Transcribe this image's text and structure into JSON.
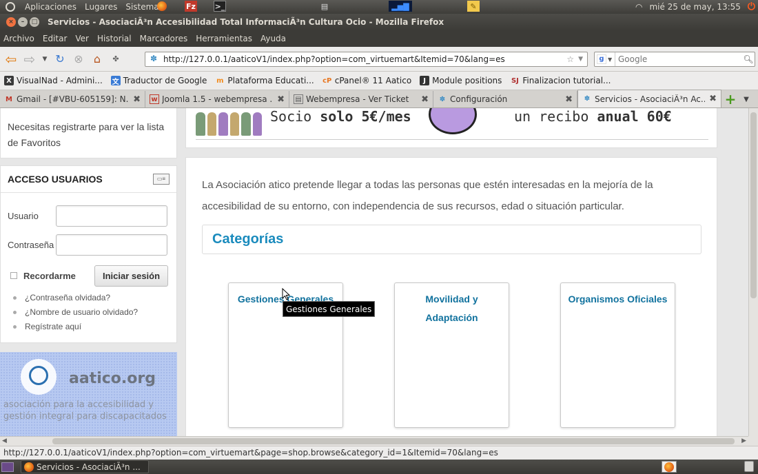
{
  "top_panel": {
    "menus": [
      "Aplicaciones",
      "Lugares",
      "Sistema"
    ],
    "clock": "mié 25 de may, 13:55",
    "app_icons": [
      "firefox-icon",
      "filezilla-icon",
      "terminal-icon",
      "network-icon",
      "system-monitor-icon",
      "notes-icon"
    ]
  },
  "window": {
    "title": "Servicios - AsociaciÃ³n Accesibilidad Total InformaciÃ³n Cultura Ocio - Mozilla Firefox"
  },
  "menubar": {
    "items": [
      "Archivo",
      "Editar",
      "Ver",
      "Historial",
      "Marcadores",
      "Herramientas",
      "Ayuda"
    ]
  },
  "navbar": {
    "url": "http://127.0.0.1/aaticoV1/index.php?option=com_virtuemart&Itemid=70&lang=es",
    "search_placeholder": "Google"
  },
  "bookmarks": [
    {
      "label": "VisualNad - Admini...",
      "icon": "visualnad-icon",
      "color": "#3a3a3a"
    },
    {
      "label": "Traductor de Google",
      "icon": "translate-icon",
      "color": "#3a7bd5"
    },
    {
      "label": "Plataforma Educati...",
      "icon": "moodle-icon",
      "color": "#f28c1e"
    },
    {
      "label": "cPanel® 11 Aatico",
      "icon": "cpanel-icon",
      "color": "#e87722"
    },
    {
      "label": "Module positions",
      "icon": "joomla-icon",
      "color": "#333333"
    },
    {
      "label": "Finalizacion tutorial...",
      "icon": "sj-icon",
      "color": "#b03030"
    }
  ],
  "tabs": [
    {
      "label": "Gmail - [#VBU-605159]: N...",
      "icon": "gmail-icon"
    },
    {
      "label": "Joomla 1.5 - webempresa ...",
      "icon": "webempresa-icon"
    },
    {
      "label": "Webempresa - Ver Ticket",
      "icon": "page-icon"
    },
    {
      "label": "Configuración",
      "icon": "site-icon"
    },
    {
      "label": "Servicios - AsociaciÃ³n Ac...",
      "icon": "site-icon"
    }
  ],
  "sidebar": {
    "favorites_notice": "Necesitas registrarte para ver la lista de Favoritos",
    "login": {
      "title": "ACCESO USUARIOS",
      "username_label": "Usuario",
      "password_label": "Contraseña",
      "remember_label": "Recordarme",
      "submit_label": "Iniciar sesión",
      "links": [
        "¿Contraseña olvidada?",
        "¿Nombre de usuario olvidado?",
        "Regístrate aquí"
      ]
    },
    "banner": {
      "brand": "aatico.org",
      "tagline": "asociación para la accesibilidad y gestión integral para discapacitados"
    }
  },
  "top_banner": {
    "socio_prefix": "Socio",
    "socio_price": "solo 5€/mes",
    "recibo_prefix": "un recibo",
    "recibo_price": "anual 60€"
  },
  "main": {
    "intro": "La Asociación atico pretende llegar a todas las personas que estén interesadas en la mejoría de la accesibilidad de su entorno, con independencia de sus recursos, edad o situación particular.",
    "categories_title": "Categorías",
    "categories": [
      {
        "label": "Gestiones Generales"
      },
      {
        "label": "Movilidad y Adaptación"
      },
      {
        "label": "Organismos Oficiales"
      }
    ],
    "tooltip": "Gestiones Generales"
  },
  "statusbar": {
    "text": "http://127.0.0.1/aaticoV1/index.php?option=com_virtuemart&page=shop.browse&category_id=1&Itemid=70&lang=es"
  },
  "bottom_panel": {
    "task_label": "Servicios - AsociaciÃ³n ..."
  },
  "colors": {
    "accent": "#1a8bbd",
    "category_link": "#11729e",
    "panel": "#3c3b37"
  }
}
